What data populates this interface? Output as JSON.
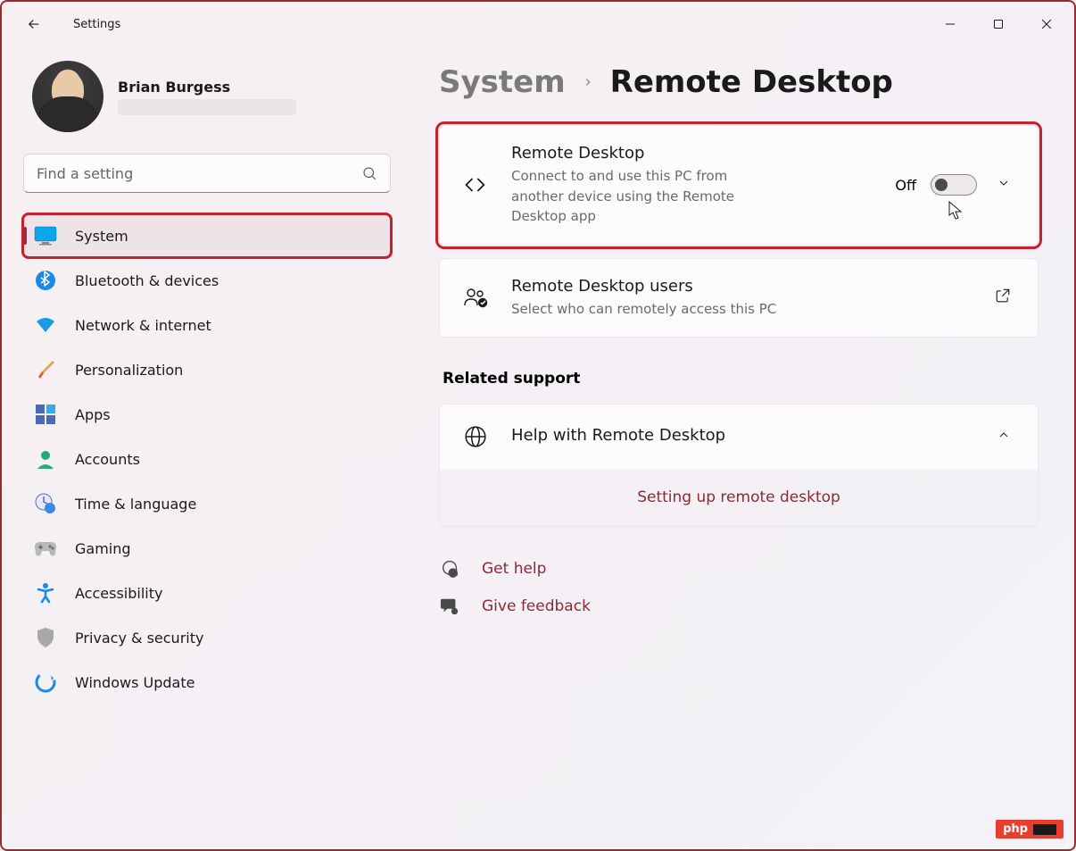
{
  "window": {
    "title": "Settings"
  },
  "profile": {
    "name": "Brian Burgess"
  },
  "search": {
    "placeholder": "Find a setting"
  },
  "sidebar": {
    "items": [
      {
        "label": "System",
        "selected": true
      },
      {
        "label": "Bluetooth & devices"
      },
      {
        "label": "Network & internet"
      },
      {
        "label": "Personalization"
      },
      {
        "label": "Apps"
      },
      {
        "label": "Accounts"
      },
      {
        "label": "Time & language"
      },
      {
        "label": "Gaming"
      },
      {
        "label": "Accessibility"
      },
      {
        "label": "Privacy & security"
      },
      {
        "label": "Windows Update"
      }
    ]
  },
  "breadcrumb": {
    "parent": "System",
    "current": "Remote Desktop"
  },
  "remote_desktop_card": {
    "title": "Remote Desktop",
    "desc": "Connect to and use this PC from another device using the Remote Desktop app",
    "state_label": "Off"
  },
  "users_card": {
    "title": "Remote Desktop users",
    "desc": "Select who can remotely access this PC"
  },
  "related_support": {
    "heading": "Related support",
    "help_title": "Help with Remote Desktop",
    "help_link": "Setting up remote desktop"
  },
  "footer": {
    "get_help": "Get help",
    "give_feedback": "Give feedback"
  },
  "badge": {
    "text": "php"
  }
}
